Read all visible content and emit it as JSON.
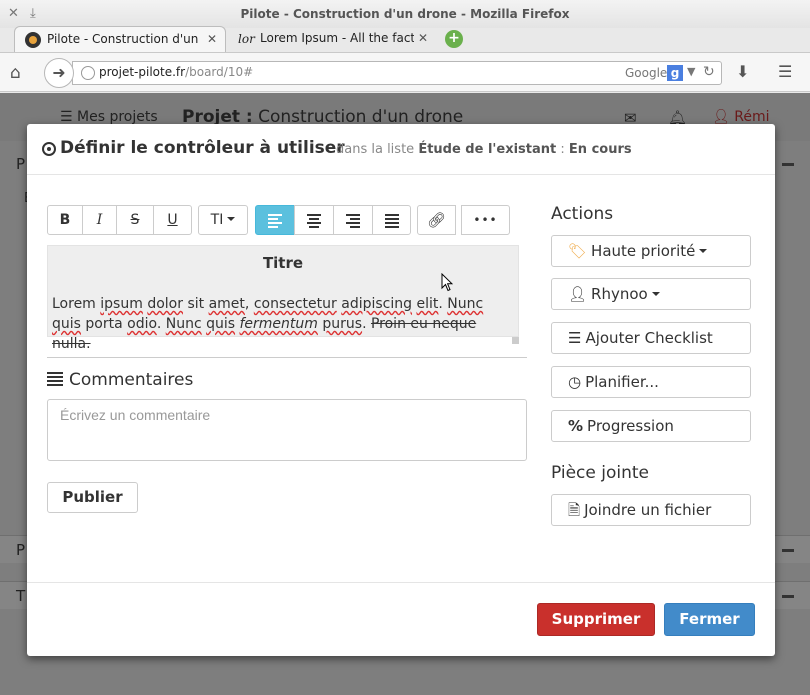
{
  "browser": {
    "window_title": "Pilote - Construction d'un drone - Mozilla Firefox",
    "tabs": [
      {
        "label": "Pilote - Construction d'un ...",
        "active": true
      },
      {
        "label": "Lorem Ipsum - All the fact...",
        "favicon_text": "lor",
        "active": false
      }
    ],
    "url_host": "projet-pilote.fr",
    "url_path": "/board/10#",
    "search_engine": "Google",
    "search_engine_badge": "g"
  },
  "page": {
    "my_projects": "Mes projets",
    "project_prefix": "Projet :",
    "project_name": "Construction d'un drone",
    "user_name": "Rémi",
    "bg_letters": [
      "P",
      "E",
      "P",
      "T"
    ]
  },
  "modal": {
    "title": "Définir le contrôleur à utiliser",
    "list_prefix": "dans la liste",
    "list_name": "Étude de l'existant",
    "status_sep": ":",
    "status": "En cours",
    "toolbar": {
      "bold": "B",
      "italic": "I",
      "strike": "S",
      "underline": "U",
      "font_size": "TI",
      "more": "•••"
    },
    "editor": {
      "heading": "Titre",
      "text_parts": {
        "p1": "Lorem ",
        "w1": "ipsum",
        "p2": " ",
        "w2": "dolor",
        "p3": " sit ",
        "w3": "amet",
        "p4": ", ",
        "w4": "consectetur",
        "p5": " ",
        "w5": "adipiscing",
        "p6": " ",
        "w6": "elit",
        "p7": ". ",
        "w7": "Nunc",
        "p8": " ",
        "w8": "quis",
        "p9": " ",
        "w9": "porta",
        "p10": " ",
        "w10": "odio",
        "p11": ". ",
        "w11": "Nunc",
        "p12": " ",
        "w12": "quis",
        "p13": " ",
        "w13": "fermentum",
        "p14": " ",
        "w14": "purus",
        "p15": ". ",
        "strike": "Proin eu neque nulla."
      }
    },
    "comments": {
      "heading": "Commentaires",
      "placeholder": "Écrivez un commentaire",
      "publish": "Publier"
    },
    "actions": {
      "heading": "Actions",
      "priority": "Haute priorité",
      "assignee": "Rhynoo",
      "checklist": "Ajouter Checklist",
      "schedule": "Planifier...",
      "progress": "Progression",
      "progress_symbol": "%"
    },
    "attachment": {
      "heading": "Pièce jointe",
      "join": "Joindre un fichier"
    },
    "footer": {
      "delete": "Supprimer",
      "close": "Fermer"
    }
  },
  "colors": {
    "accent_info": "#5bc0de",
    "danger": "#c9302c",
    "primary": "#428bca",
    "priority_tag": "#f0ad4e"
  }
}
